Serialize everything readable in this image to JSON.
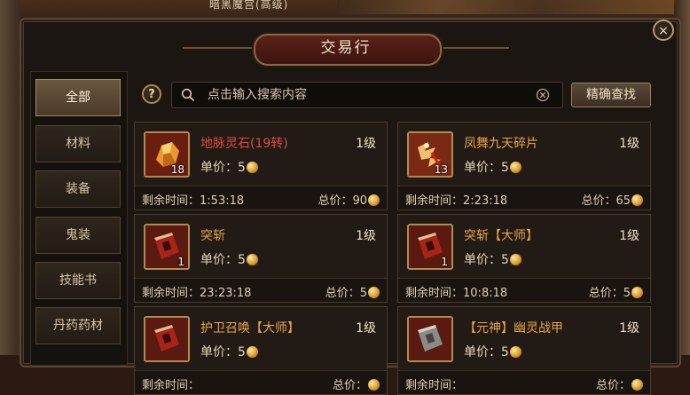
{
  "scene": {
    "top_text": "暗黑魔宫(高级)"
  },
  "window": {
    "title": "交易行",
    "close": "×"
  },
  "categories": [
    {
      "label": "全部",
      "active": true
    },
    {
      "label": "材料"
    },
    {
      "label": "装备"
    },
    {
      "label": "鬼装"
    },
    {
      "label": "技能书"
    },
    {
      "label": "丹药药材"
    }
  ],
  "search": {
    "help": "?",
    "placeholder": "点击输入搜索内容",
    "button": "精确查找"
  },
  "labels": {
    "price": "单价：",
    "remaining": "剩余时间：",
    "total": "总价："
  },
  "listings": [
    {
      "name": "地脉灵石(19转)",
      "name_color": "red",
      "level": "1级",
      "qty": "18",
      "price": "5",
      "time": "1:53:18",
      "total": "90",
      "icon": "gold-ore-icon"
    },
    {
      "name": "凤舞九天碎片",
      "name_color": "orange",
      "level": "1级",
      "qty": "13",
      "price": "5",
      "time": "2:23:18",
      "total": "65",
      "icon": "phoenix-fragment-icon"
    },
    {
      "name": "突斩",
      "name_color": "orange",
      "level": "1级",
      "qty": "1",
      "price": "5",
      "time": "23:23:18",
      "total": "5",
      "icon": "red-skill-book-icon"
    },
    {
      "name": "突斩【大师】",
      "name_color": "orange",
      "level": "1级",
      "qty": "1",
      "price": "5",
      "time": "10:8:18",
      "total": "5",
      "icon": "red-skill-book-icon"
    },
    {
      "name": "护卫召唤【大师】",
      "name_color": "orange",
      "level": "1级",
      "qty": "",
      "price": "5",
      "time": "",
      "total": "",
      "icon": "red-skill-book-icon"
    },
    {
      "name": "【元神】幽灵战甲",
      "name_color": "orange",
      "level": "1级",
      "qty": "",
      "price": "5",
      "time": "",
      "total": "",
      "icon": "grey-skill-book-icon"
    }
  ]
}
